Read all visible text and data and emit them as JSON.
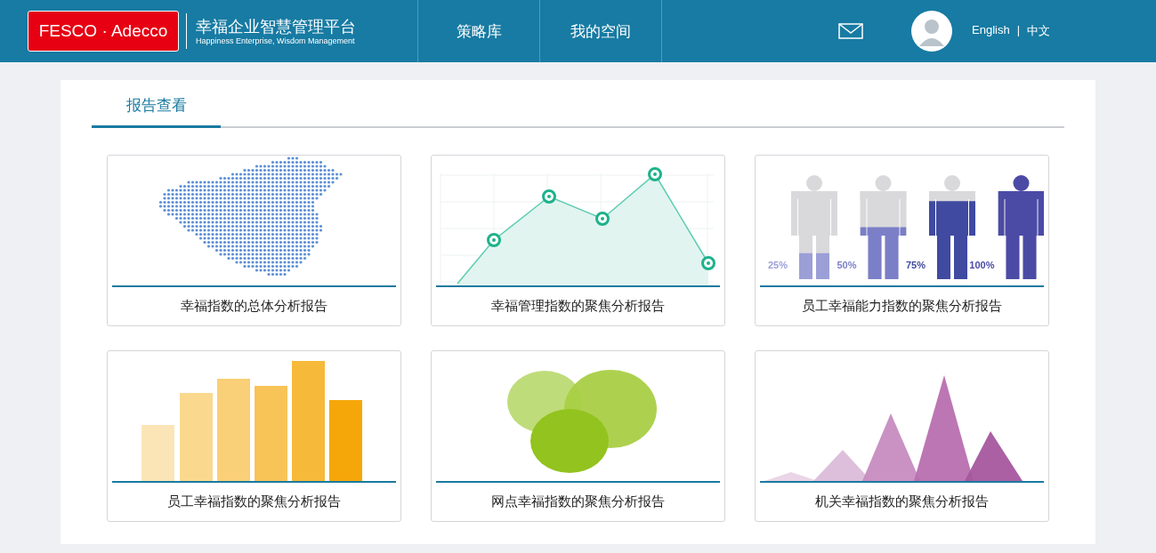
{
  "header": {
    "logo": "FESCO · Adecco",
    "title": "幸福企业智慧管理平台",
    "subtitle": "Happiness Enterprise, Wisdom Management",
    "nav": [
      {
        "label": "策略库"
      },
      {
        "label": "我的空间"
      }
    ],
    "languages": [
      {
        "label": "English"
      },
      {
        "label": "中文"
      }
    ],
    "language_separator": "|"
  },
  "tabs": [
    {
      "label": "报告查看",
      "selected": true
    }
  ],
  "cards": [
    {
      "kind": "map",
      "title": "幸福指数的总体分析报告"
    },
    {
      "kind": "line",
      "title": "幸福管理指数的聚焦分析报告"
    },
    {
      "kind": "people",
      "title": "员工幸福能力指数的聚焦分析报告",
      "figures": [
        {
          "label": "25%",
          "level": 0.25,
          "color": "#9b9fd6"
        },
        {
          "label": "50%",
          "level": 0.5,
          "color": "#7b7fc8"
        },
        {
          "label": "75%",
          "level": 0.75,
          "color": "#3f4aa0"
        },
        {
          "label": "100%",
          "level": 1,
          "color": "#4b4ba6"
        }
      ]
    },
    {
      "kind": "bars",
      "title": "员工幸福指数的聚焦分析报告"
    },
    {
      "kind": "bubbles",
      "title": "网点幸福指数的聚焦分析报告"
    },
    {
      "kind": "peaks",
      "title": "机关幸福指数的聚焦分析报告"
    }
  ]
}
